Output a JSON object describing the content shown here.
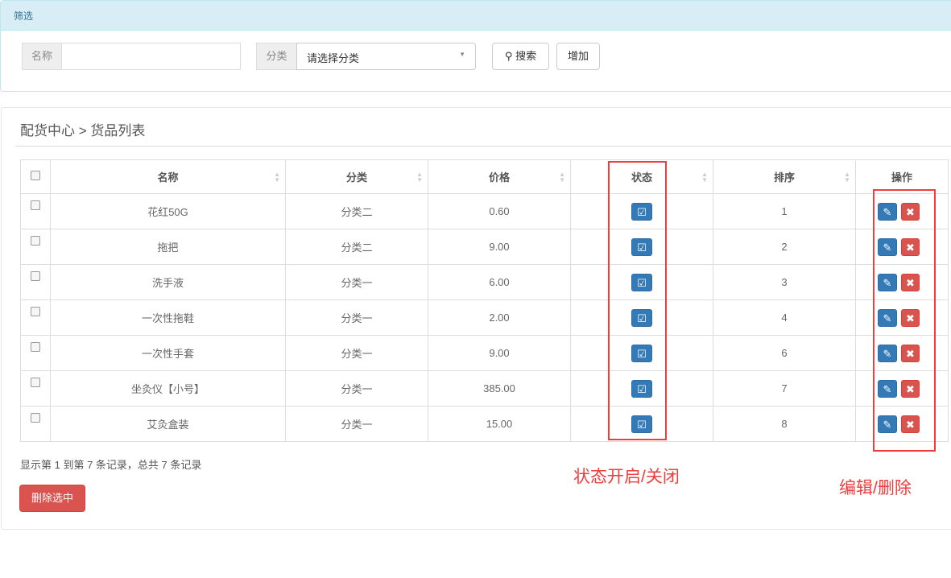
{
  "filter": {
    "title": "筛选",
    "name_label": "名称",
    "name_value": "",
    "category_label": "分类",
    "category_selected": "请选择分类",
    "search_label": "搜索",
    "add_label": "增加"
  },
  "list": {
    "breadcrumb": "配货中心 > 货品列表",
    "columns": [
      "名称",
      "分类",
      "价格",
      "状态",
      "排序",
      "操作"
    ],
    "rows": [
      {
        "name": "花红50G",
        "category": "分类二",
        "price": "0.60",
        "order": "1"
      },
      {
        "name": "拖把",
        "category": "分类二",
        "price": "9.00",
        "order": "2"
      },
      {
        "name": "洗手液",
        "category": "分类一",
        "price": "6.00",
        "order": "3"
      },
      {
        "name": "一次性拖鞋",
        "category": "分类一",
        "price": "2.00",
        "order": "4"
      },
      {
        "name": "一次性手套",
        "category": "分类一",
        "price": "9.00",
        "order": "6"
      },
      {
        "name": "坐灸仪【小号】",
        "category": "分类一",
        "price": "385.00",
        "order": "7"
      },
      {
        "name": "艾灸盒装",
        "category": "分类一",
        "price": "15.00",
        "order": "8"
      }
    ],
    "summary": "显示第 1 到第 7 条记录，总共 7 条记录",
    "delete_selected": "删除选中"
  },
  "annotations": {
    "status": "状态开启/关闭",
    "actions": "编辑/删除"
  }
}
